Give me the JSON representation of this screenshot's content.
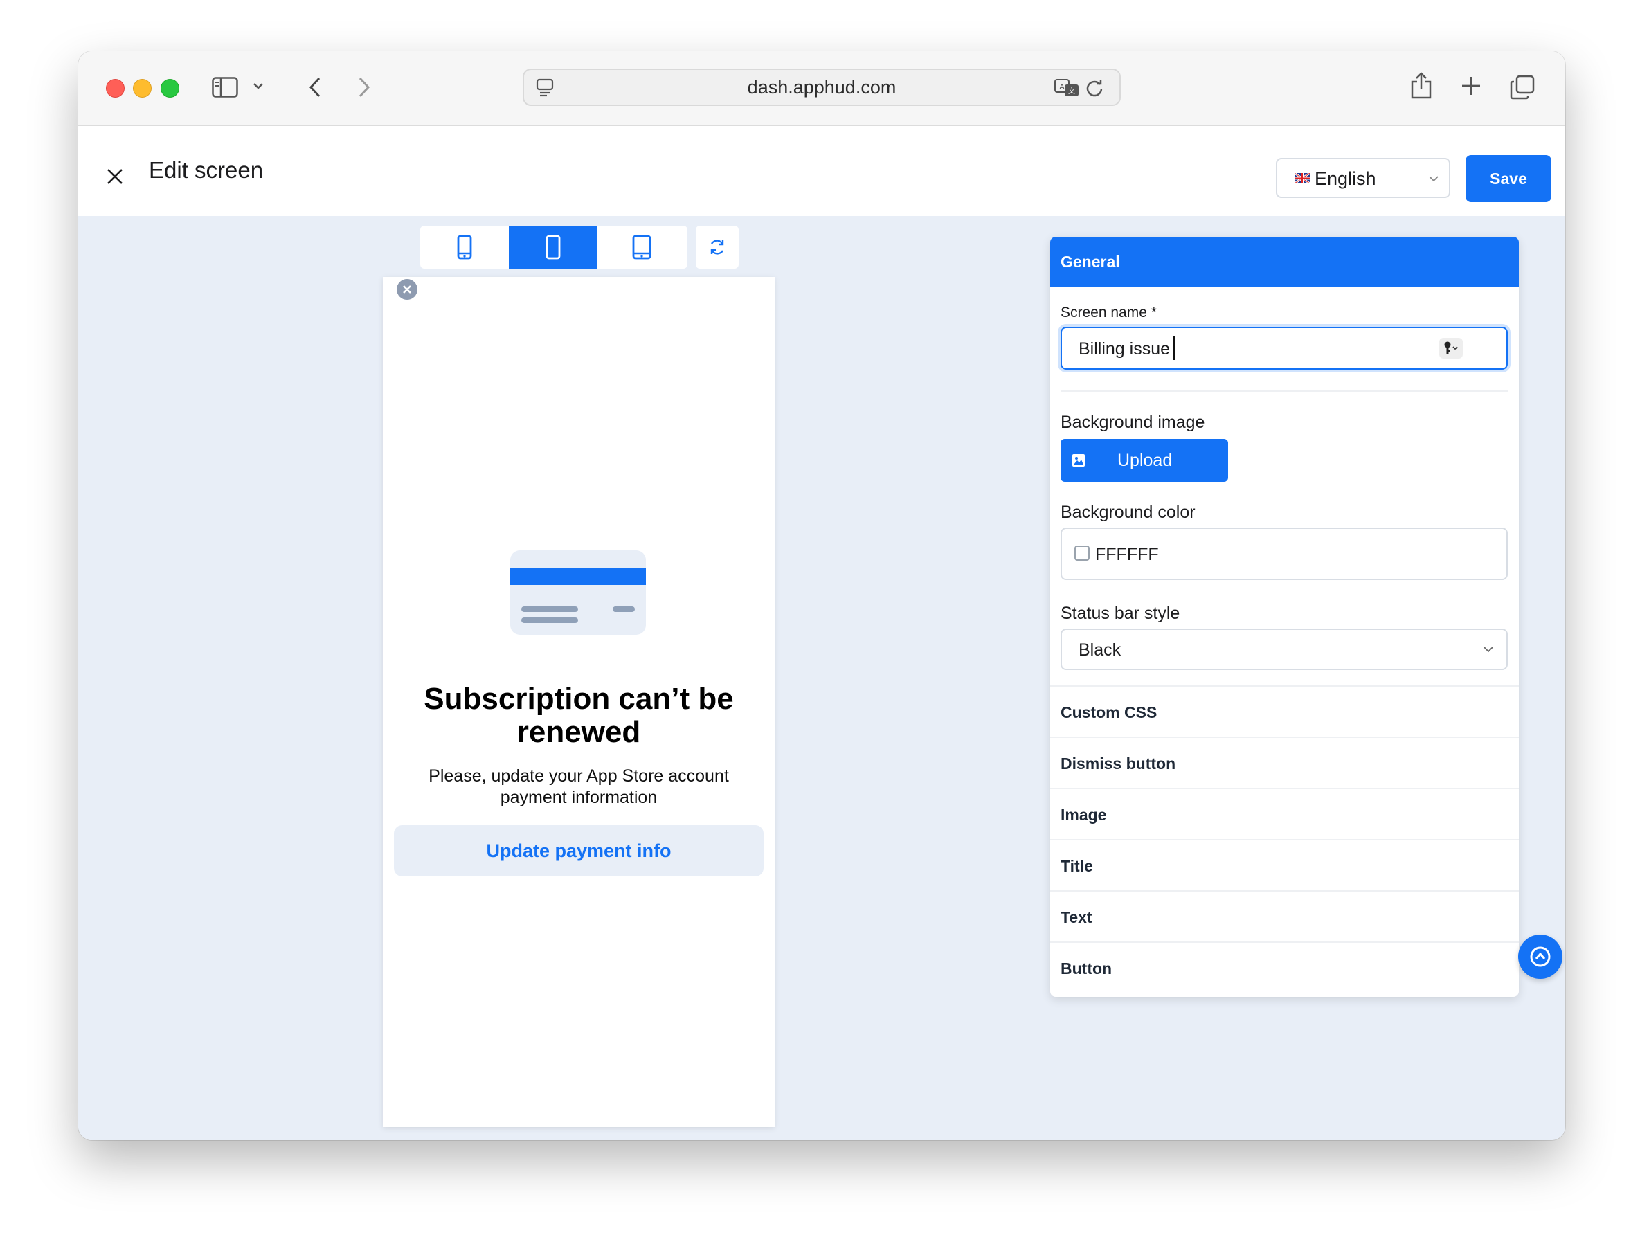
{
  "browser": {
    "url": "dash.apphud.com"
  },
  "header": {
    "title": "Edit screen",
    "language": "English",
    "save_label": "Save"
  },
  "preview": {
    "title": "Subscription can’t be renewed",
    "text": "Please, update your App Store account payment information",
    "button_label": "Update payment info"
  },
  "panel": {
    "section_title": "General",
    "screen_name_label": "Screen name *",
    "screen_name_value": "Billing issue",
    "background_image_label": "Background image",
    "upload_label": "Upload",
    "background_color_label": "Background color",
    "background_color_value": "FFFFFF",
    "status_bar_label": "Status bar style",
    "status_bar_value": "Black",
    "sections": [
      "Custom CSS",
      "Dismiss button",
      "Image",
      "Title",
      "Text",
      "Button"
    ]
  },
  "colors": {
    "accent": "#1472f5",
    "canvas": "#e8eef7"
  }
}
